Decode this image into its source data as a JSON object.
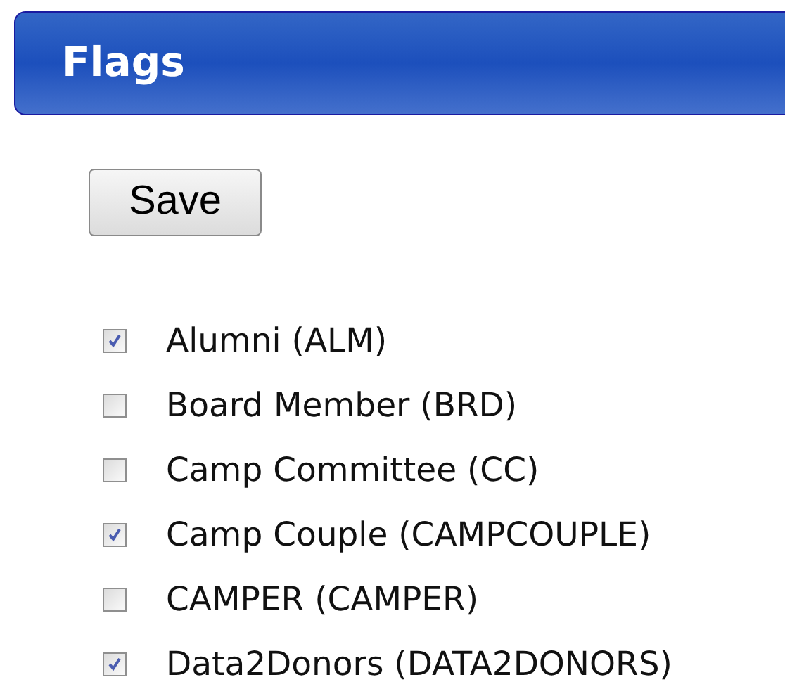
{
  "header": {
    "title": "Flags"
  },
  "save_button": "Save",
  "flags": [
    {
      "label": "Alumni (ALM)",
      "checked": true
    },
    {
      "label": "Board Member (BRD)",
      "checked": false
    },
    {
      "label": "Camp Committee (CC)",
      "checked": false
    },
    {
      "label": "Camp Couple (CAMPCOUPLE)",
      "checked": true
    },
    {
      "label": "CAMPER (CAMPER)",
      "checked": false
    },
    {
      "label": "Data2Donors (DATA2DONORS)",
      "checked": true
    }
  ]
}
